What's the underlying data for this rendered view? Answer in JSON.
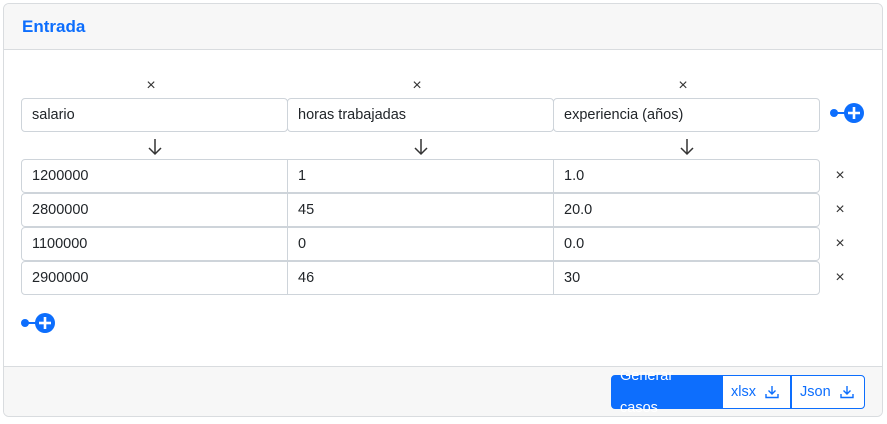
{
  "title": "Entrada",
  "columns": [
    {
      "name": "salario"
    },
    {
      "name": "horas trabajadas"
    },
    {
      "name": "experiencia (años)"
    }
  ],
  "rows": [
    [
      "1200000",
      "1",
      "1.0"
    ],
    [
      "2800000",
      "45",
      "20.0"
    ],
    [
      "1100000",
      "0",
      "0.0"
    ],
    [
      "2900000",
      "46",
      "30"
    ]
  ],
  "icons": {
    "remove": "×",
    "add_column": "plus-circle-icon",
    "add_row": "plus-circle-icon",
    "download": "download-icon",
    "arrow": "arrow-down-icon"
  },
  "footer": {
    "generate_label": "Generar casos",
    "xlsx_label": "xlsx",
    "json_label": "Json"
  },
  "colors": {
    "accent": "#0d6efd",
    "border": "#ced4da",
    "header_bg": "#f7f7f7"
  }
}
